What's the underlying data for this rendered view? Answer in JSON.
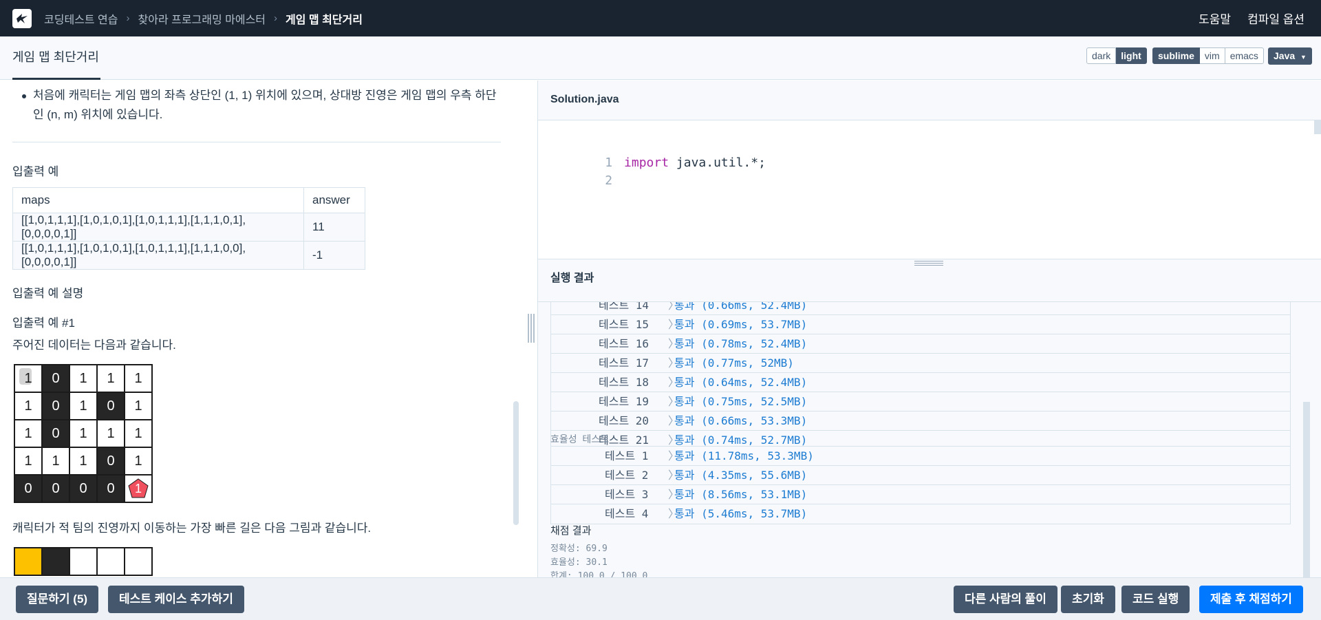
{
  "nav": {
    "breadcrumb": [
      "코딩테스트 연습",
      "찾아라 프로그래밍 마에스터",
      "게임 맵 최단거리"
    ],
    "links": [
      "도움말",
      "컴파일 옵션"
    ]
  },
  "subheader": {
    "problem_tab": "게임 맵 최단거리",
    "theme_options": [
      "dark",
      "light"
    ],
    "theme_selected": "light",
    "keymap_options": [
      "sublime",
      "vim",
      "emacs"
    ],
    "keymap_selected": "sublime",
    "language": "Java"
  },
  "problem": {
    "bullet_text": "처음에 캐릭터는 게임 맵의 좌측 상단인 (1, 1) 위치에 있으며, 상대방 진영은 게임 맵의 우측 하단인 (n, m) 위치에 있습니다.",
    "io_heading": "입출력 예",
    "io_table": {
      "headers": [
        "maps",
        "answer"
      ],
      "rows": [
        [
          "[[1,0,1,1,1],[1,0,1,0,1],[1,0,1,1,1],[1,1,1,0,1],[0,0,0,0,1]]",
          "11"
        ],
        [
          "[[1,0,1,1,1],[1,0,1,0,1],[1,0,1,1,1],[1,1,1,0,0],[0,0,0,0,1]]",
          "-1"
        ]
      ]
    },
    "explain_heading": "입출력 예 설명",
    "example1_heading": "입출력 예 #1",
    "example1_text": "주어진 데이터는 다음과 같습니다.",
    "map_grid": [
      [
        "1",
        "0",
        "1",
        "1",
        "1"
      ],
      [
        "1",
        "0",
        "1",
        "0",
        "1"
      ],
      [
        "1",
        "0",
        "1",
        "1",
        "1"
      ],
      [
        "1",
        "1",
        "1",
        "0",
        "1"
      ],
      [
        "0",
        "0",
        "0",
        "0",
        "1"
      ]
    ],
    "path_text": "캐릭터가 적 팀의 진영까지 이동하는 가장 빠른 길은 다음 그림과 같습니다."
  },
  "editor": {
    "filename": "Solution.java",
    "lines": [
      {
        "num": "1",
        "keyword": "import",
        "rest": " java.util.*;"
      },
      {
        "num": "2",
        "keyword": "",
        "rest": ""
      }
    ]
  },
  "result": {
    "title": "실행 결과",
    "accuracy_tests": [
      {
        "name": "테스트 14",
        "result": "통과 (0.66ms, 52.4MB)"
      },
      {
        "name": "테스트 15",
        "result": "통과 (0.69ms, 53.7MB)"
      },
      {
        "name": "테스트 16",
        "result": "통과 (0.78ms, 52.4MB)"
      },
      {
        "name": "테스트 17",
        "result": "통과 (0.77ms, 52MB)"
      },
      {
        "name": "테스트 18",
        "result": "통과 (0.64ms, 52.4MB)"
      },
      {
        "name": "테스트 19",
        "result": "통과 (0.75ms, 52.5MB)"
      },
      {
        "name": "테스트 20",
        "result": "통과 (0.66ms, 53.3MB)"
      },
      {
        "name": "테스트 21",
        "result": "통과 (0.74ms, 52.7MB)"
      }
    ],
    "efficiency_label": "효율성  테스트",
    "efficiency_tests": [
      {
        "name": "테스트 1",
        "result": "통과 (11.78ms, 53.3MB)"
      },
      {
        "name": "테스트 2",
        "result": "통과 (4.35ms, 55.6MB)"
      },
      {
        "name": "테스트 3",
        "result": "통과 (8.56ms, 53.1MB)"
      },
      {
        "name": "테스트 4",
        "result": "통과 (5.46ms, 53.7MB)"
      }
    ],
    "chevron": "〉",
    "score_title": "채점 결과",
    "score_lines": [
      "정확성: 69.9",
      "효율성: 30.1",
      "합계: 100.0 / 100.0"
    ]
  },
  "bottom": {
    "left_buttons": [
      "질문하기 (5)",
      "테스트 케이스 추가하기"
    ],
    "right_buttons": [
      "다른 사람의 풀이",
      "초기화",
      "코드 실행",
      "제출 후 채점하기"
    ]
  },
  "colors": {
    "nav_bg": "#1a2330",
    "button_bg": "#44576c",
    "primary": "#0078ff",
    "pass_text": "#1d7cd2",
    "wall": "#262626",
    "path": "#fdc100",
    "goal": "#f04f5e"
  }
}
